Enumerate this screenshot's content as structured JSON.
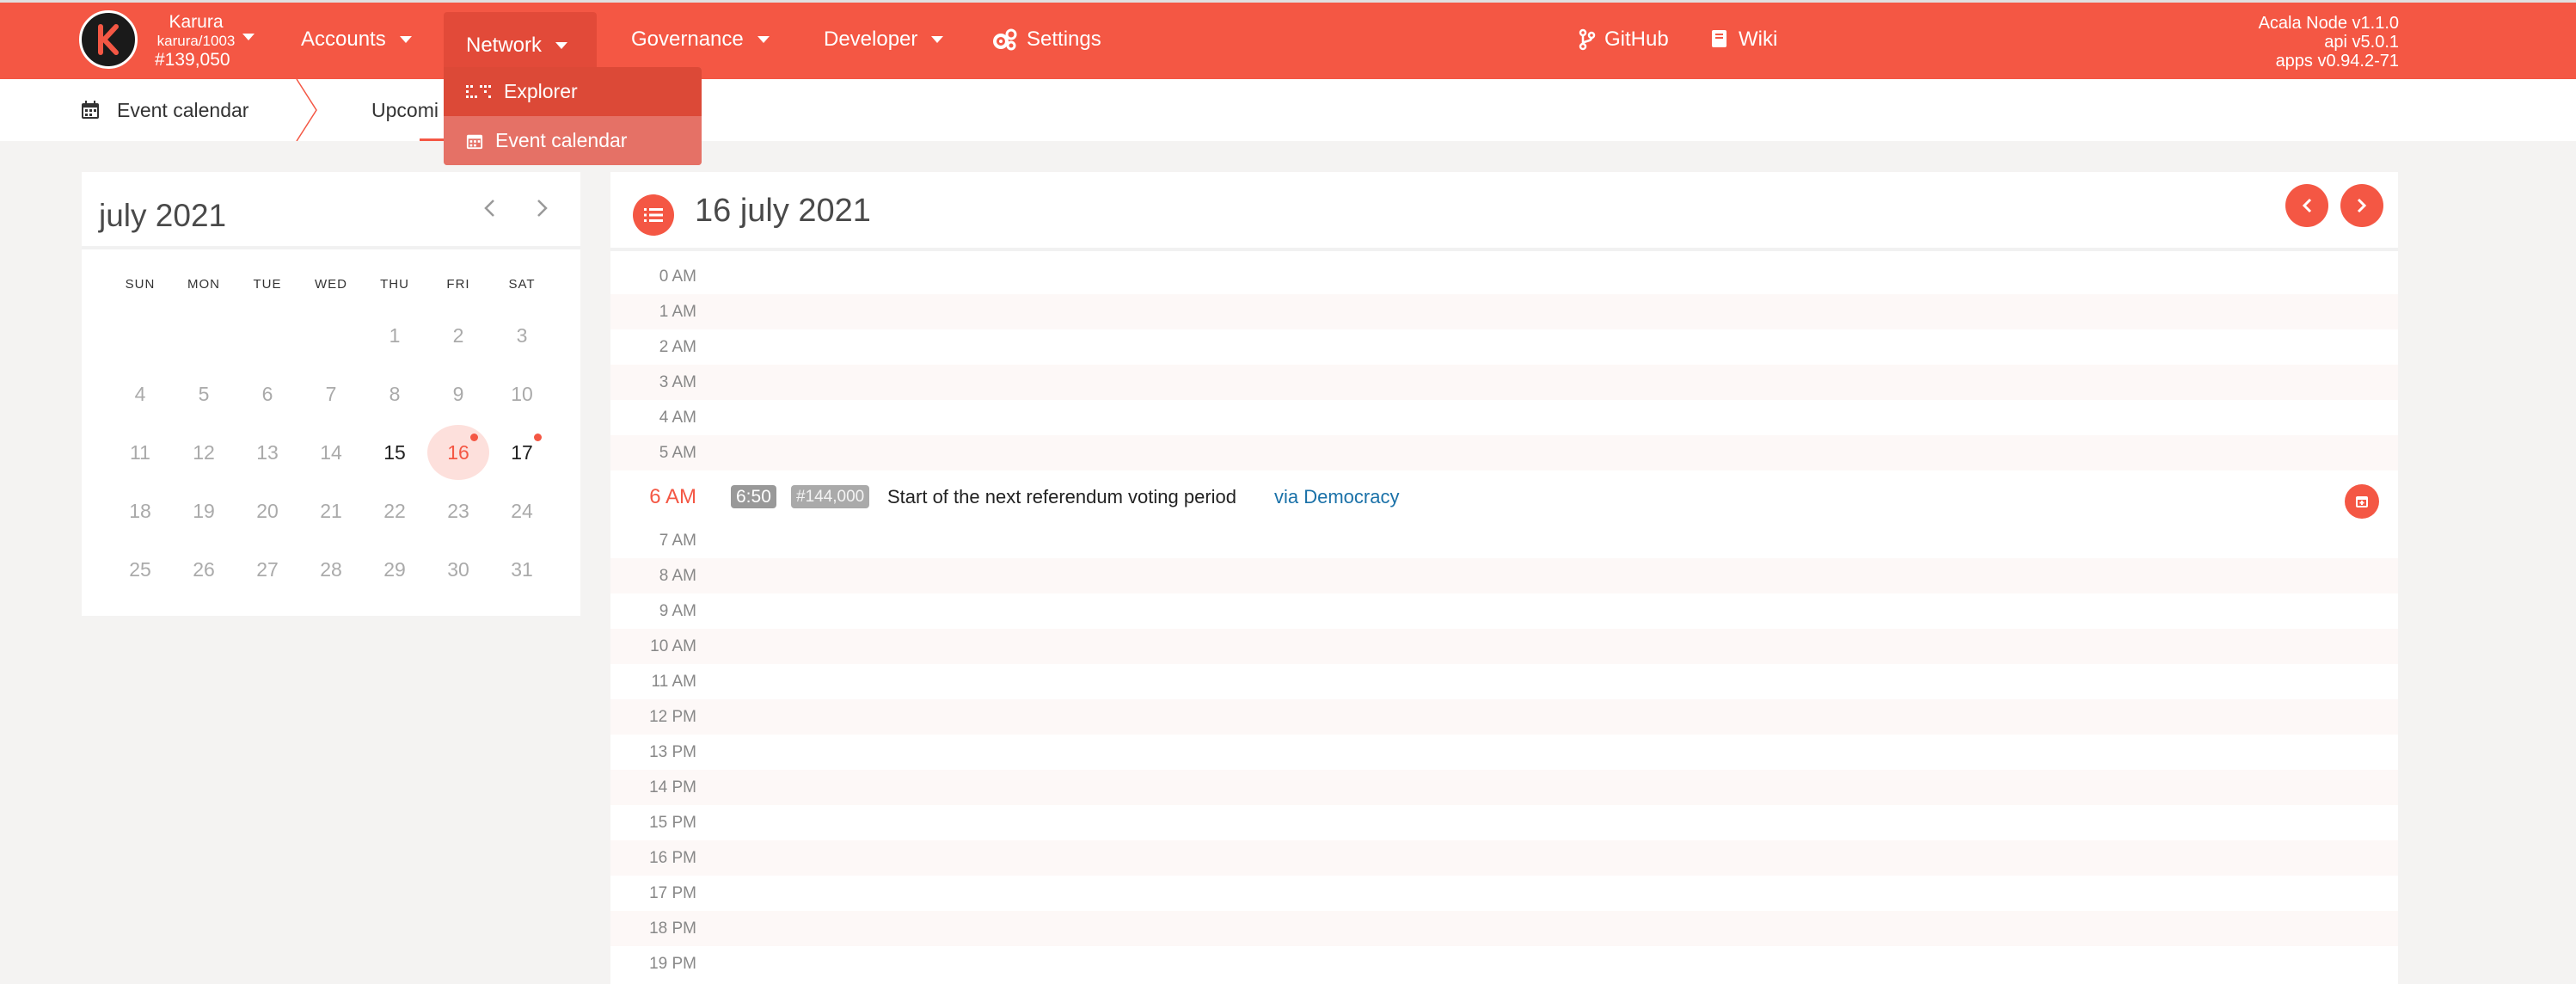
{
  "header": {
    "chain": {
      "name": "Karura",
      "id": "karura/1003",
      "block": "#139,050"
    },
    "nav": {
      "accounts": "Accounts",
      "network": "Network",
      "governance": "Governance",
      "developer": "Developer",
      "settings": "Settings",
      "github": "GitHub",
      "wiki": "Wiki"
    },
    "version": {
      "node": "Acala Node v1.1.0",
      "api": "api v5.0.1",
      "apps": "apps v0.94.2-71"
    },
    "network_menu": [
      {
        "label": "Explorer",
        "icon": "grid-dots-icon"
      },
      {
        "label": "Event calendar",
        "icon": "calendar-icon"
      }
    ],
    "accent_color": "#f45744"
  },
  "tabs": {
    "event_calendar": "Event calendar",
    "upcoming": "Upcomi"
  },
  "mini_calendar": {
    "month_label": "july 2021",
    "weekdays": [
      "SUN",
      "MON",
      "TUE",
      "WED",
      "THU",
      "FRI",
      "SAT"
    ],
    "days": [
      "1",
      "2",
      "3",
      "4",
      "5",
      "6",
      "7",
      "8",
      "9",
      "10",
      "11",
      "12",
      "13",
      "14",
      "15",
      "16",
      "17",
      "18",
      "19",
      "20",
      "21",
      "22",
      "23",
      "24",
      "25",
      "26",
      "27",
      "28",
      "29",
      "30",
      "31"
    ],
    "selected_day": "16",
    "days_with_events": [
      "16",
      "17"
    ]
  },
  "day_view": {
    "title": "16 july 2021",
    "hours_before": [
      "0 AM",
      "1 AM",
      "2 AM",
      "3 AM",
      "4 AM",
      "5 AM"
    ],
    "event_hour": "6 AM",
    "hours_after": [
      "7 AM",
      "8 AM",
      "9 AM",
      "10 AM",
      "11 AM",
      "12 PM",
      "13 PM",
      "14 PM",
      "15 PM",
      "16 PM",
      "17 PM",
      "18 PM",
      "19 PM"
    ],
    "event": {
      "time": "6:50",
      "block": "#144,000",
      "text": "Start of the next referendum voting period",
      "link": "via Democracy"
    }
  }
}
